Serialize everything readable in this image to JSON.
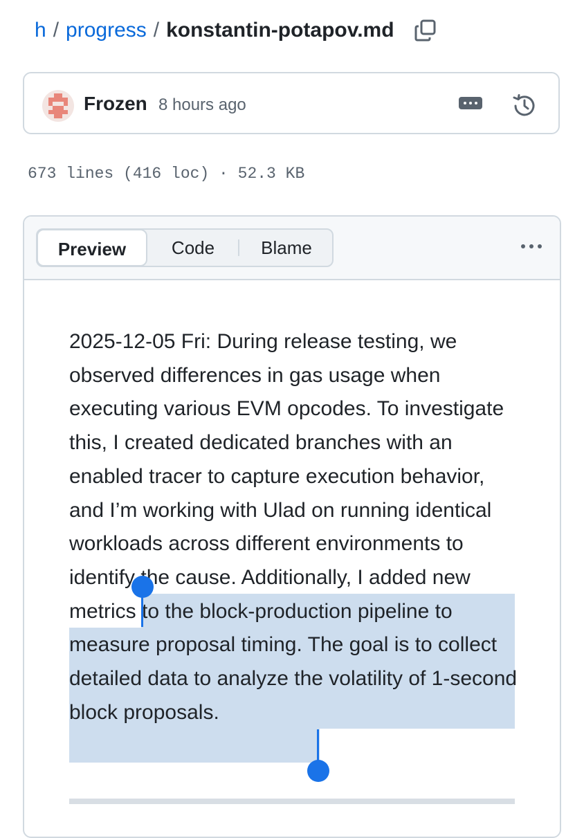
{
  "breadcrumb": {
    "root": "h",
    "folder": "progress",
    "separator": "/",
    "file": "konstantin-potapov.md",
    "copy_icon": "copy-icon"
  },
  "commit": {
    "author": "Frozen",
    "time": "8 hours ago",
    "more_icon": "ellipsis-icon",
    "history_icon": "history-icon"
  },
  "file_info": "673 lines (416 loc) · 52.3 KB",
  "tabs": [
    {
      "label": "Preview",
      "selected": true
    },
    {
      "label": "Code",
      "selected": false
    },
    {
      "label": "Blame",
      "selected": false
    }
  ],
  "content": {
    "paragraph": "2025-12-05 Fri: During release testing, we observed differences in gas usage when executing various EVM opcodes. To investigate this, I created dedicated branches with an enabled tracer to capture execution behavior, and I’m working with Ulad on running identical workloads across different environments to identify the cause. Additionally, I added new metrics to the block-production pipeline to measure proposal timing. The goal is to collect detailed data to analyze the volatility of 1-second block proposals."
  },
  "colors": {
    "link": "#0969da",
    "selection": "#cdddee",
    "handle": "#1a73e8",
    "border": "#d1d9e0"
  }
}
